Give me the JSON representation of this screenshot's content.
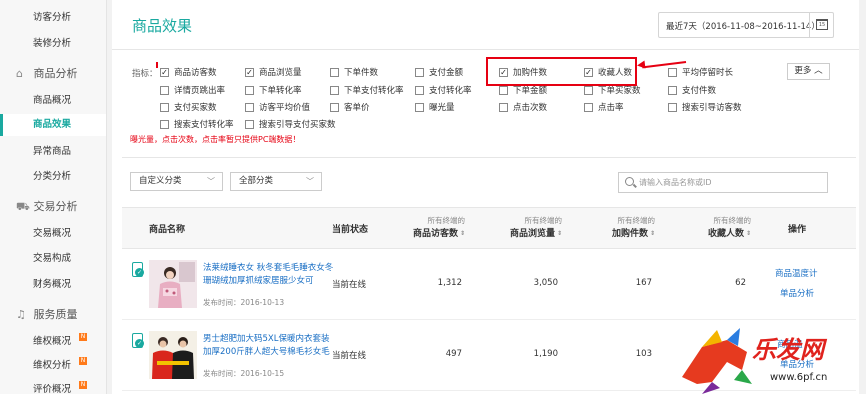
{
  "sidebar": {
    "top_items": [
      "访客分析",
      "装修分析"
    ],
    "groups": [
      {
        "label": "商品分析",
        "icon": "cube-icon",
        "items": [
          "商品概况",
          "商品效果",
          "异常商品",
          "分类分析"
        ]
      },
      {
        "label": "交易分析",
        "icon": "cart-icon",
        "items": [
          "交易概况",
          "交易构成",
          "财务概况"
        ]
      },
      {
        "label": "服务质量",
        "icon": "headset-icon",
        "items": [
          "维权概况",
          "维权分析",
          "评价概况"
        ]
      }
    ],
    "active_item": "商品效果",
    "badges": [
      "N",
      "N",
      "N"
    ]
  },
  "header": {
    "title": "商品效果",
    "date_range": "最近7天（2016-11-08~2016-11-14）",
    "calendar_label": "15"
  },
  "metrics": {
    "label": "指标：",
    "more_label": "更多",
    "items": [
      {
        "label": "商品访客数",
        "checked": true
      },
      {
        "label": "商品浏览量",
        "checked": true
      },
      {
        "label": "下单件数",
        "checked": false
      },
      {
        "label": "支付金额",
        "checked": false
      },
      {
        "label": "加购件数",
        "checked": true
      },
      {
        "label": "收藏人数",
        "checked": true
      },
      {
        "label": "平均停留时长",
        "checked": false
      },
      {
        "label": "详情页跳出率",
        "checked": false
      },
      {
        "label": "下单转化率",
        "checked": false
      },
      {
        "label": "下单支付转化率",
        "checked": false
      },
      {
        "label": "支付转化率",
        "checked": false
      },
      {
        "label": "下单金额",
        "checked": false
      },
      {
        "label": "下单买家数",
        "checked": false
      },
      {
        "label": "支付件数",
        "checked": false
      },
      {
        "label": "支付买家数",
        "checked": false
      },
      {
        "label": "访客平均价值",
        "checked": false
      },
      {
        "label": "客单价",
        "checked": false
      },
      {
        "label": "曝光量",
        "checked": false
      },
      {
        "label": "点击次数",
        "checked": false
      },
      {
        "label": "点击率",
        "checked": false
      },
      {
        "label": "搜索引导访客数",
        "checked": false
      },
      {
        "label": "搜索支付转化率",
        "checked": false
      },
      {
        "label": "搜索引导支付买家数",
        "checked": false
      }
    ],
    "note": "曝光量，点击次数，点击率暂只提供PC端数据！"
  },
  "filters": {
    "category1": "自定义分类",
    "category2": "全部分类",
    "search_placeholder": "请输入商品名称或ID"
  },
  "table": {
    "columns": {
      "name": "商品名称",
      "status": "当前状态",
      "sub": "所有终端的",
      "visitors": "商品访客数",
      "views": "商品浏览量",
      "cart": "加购件数",
      "fav": "收藏人数",
      "ops": "操作"
    },
    "rows": [
      {
        "name": "法莱绒睡衣女 秋冬套毛毛睡衣女冬 珊瑚绒加厚抓绒家居服少女可",
        "published": "发布时间：2016-10-13",
        "status": "当前在线",
        "visitors": "1,312",
        "views": "3,050",
        "cart": "167",
        "fav": "62",
        "op1": "商品温度计",
        "op2": "单品分析"
      },
      {
        "name": "男士超肥加大码5XL保暖内衣套装 加厚200斤胖人超大号棉毛衫女毛",
        "published": "发布时间：2016-10-15",
        "status": "当前在线",
        "visitors": "497",
        "views": "1,190",
        "cart": "103",
        "fav": "",
        "op1": "商品温",
        "op2": "单品分析"
      }
    ]
  },
  "watermark": {
    "brand": "乐发网",
    "url": "www.6pf.cn"
  }
}
